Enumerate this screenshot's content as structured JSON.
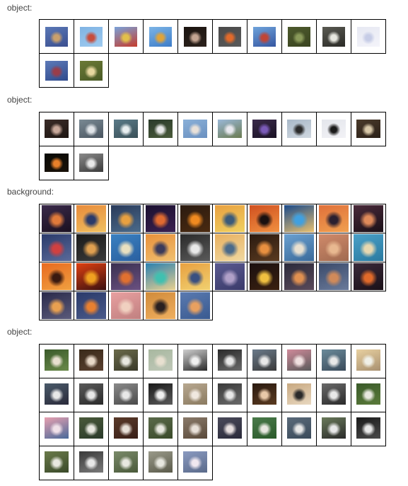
{
  "sections": [
    {
      "label": "object:",
      "type": "object-a",
      "images": [
        {
          "name": "blue-hot-air-balloon",
          "colors": [
            "#5a78b6",
            "#c9a06c",
            "#3b4f8f"
          ]
        },
        {
          "name": "red-balloon-small",
          "colors": [
            "#7fb3e3",
            "#c84d3c",
            "#9fcbf0"
          ]
        },
        {
          "name": "yellow-red-balloon",
          "colors": [
            "#7aa2d9",
            "#e2c04a",
            "#c53c2c"
          ]
        },
        {
          "name": "colorful-balloon",
          "colors": [
            "#7cb4e6",
            "#e0a43a",
            "#3d7cc8"
          ]
        },
        {
          "name": "dark-portrait",
          "colors": [
            "#1b1410",
            "#c4a592",
            "#2c221c"
          ]
        },
        {
          "name": "orange-figure",
          "colors": [
            "#4a4a4a",
            "#e26a2a",
            "#5a5a5a"
          ]
        },
        {
          "name": "balloon-flag",
          "colors": [
            "#6fa3db",
            "#c04536",
            "#3556a0"
          ]
        },
        {
          "name": "green-plant",
          "colors": [
            "#4d5a2d",
            "#8a9a5a",
            "#3a4420"
          ]
        },
        {
          "name": "white-flower-stem",
          "colors": [
            "#5a5a52",
            "#e8e8e0",
            "#2a2a26"
          ]
        },
        {
          "name": "pale-blue-object",
          "colors": [
            "#e6e8f2",
            "#c6cce6",
            "#f4f4fa"
          ]
        },
        {
          "name": "balloon-sky",
          "colors": [
            "#5d7ab8",
            "#9a3d4a",
            "#2f4a8c"
          ]
        },
        {
          "name": "bud-flower",
          "colors": [
            "#6b7a36",
            "#e8d8a0",
            "#4a5a26"
          ]
        }
      ]
    },
    {
      "label": "object:",
      "type": "object-b",
      "images": [
        {
          "name": "dark-flower",
          "colors": [
            "#3a2c28",
            "#c8a89a",
            "#1e1612"
          ]
        },
        {
          "name": "bird-flying",
          "colors": [
            "#7a8a94",
            "#e0e4e8",
            "#4a5560"
          ]
        },
        {
          "name": "bird-water",
          "colors": [
            "#5a7a88",
            "#e8eef0",
            "#3a5058"
          ]
        },
        {
          "name": "bird-branch",
          "colors": [
            "#2a3a2a",
            "#e8e8e8",
            "#4a5a3a"
          ]
        },
        {
          "name": "bird-sky",
          "colors": [
            "#8ab0d8",
            "#e8e0d8",
            "#6a90c0"
          ]
        },
        {
          "name": "blossom-branch",
          "colors": [
            "#9ab8d8",
            "#e8e8ee",
            "#6a7a50"
          ]
        },
        {
          "name": "purple-flower",
          "colors": [
            "#3a2a4a",
            "#7a5ab8",
            "#1a1224"
          ]
        },
        {
          "name": "bird-silhouette",
          "colors": [
            "#a8b8c8",
            "#2a2a2a",
            "#d0d8e0"
          ]
        },
        {
          "name": "black-bird",
          "colors": [
            "#e4e6ec",
            "#1a1a1a",
            "#f2f2f6"
          ]
        },
        {
          "name": "brown-flower",
          "colors": [
            "#4a3a2a",
            "#d8c8a8",
            "#2a2018"
          ]
        },
        {
          "name": "orange-lily",
          "colors": [
            "#0a0a06",
            "#e8802a",
            "#1a1208"
          ]
        },
        {
          "name": "gray-sign",
          "colors": [
            "#8a8a8a",
            "#e8e8e8",
            "#3a3a3a"
          ]
        }
      ]
    },
    {
      "label": "background:",
      "type": "background",
      "images": [
        {
          "name": "sunset-1",
          "colors": [
            "#3a2a4a",
            "#e07a3a",
            "#1a1020"
          ]
        },
        {
          "name": "sunset-2",
          "colors": [
            "#e88a3a",
            "#2a3a6a",
            "#f0c060"
          ]
        },
        {
          "name": "sunset-3",
          "colors": [
            "#2a3a5a",
            "#e8a040",
            "#4a6a8a"
          ]
        },
        {
          "name": "sunset-4",
          "colors": [
            "#1a1030",
            "#e06a30",
            "#3a2050"
          ]
        },
        {
          "name": "sunset-5",
          "colors": [
            "#2a1a10",
            "#f08a20",
            "#4a2a10"
          ]
        },
        {
          "name": "sunset-6",
          "colors": [
            "#e8a040",
            "#3a5a7a",
            "#f0d060"
          ]
        },
        {
          "name": "sunset-7",
          "colors": [
            "#d05020",
            "#1a1010",
            "#f09040"
          ]
        },
        {
          "name": "sunset-8",
          "colors": [
            "#1a4a8a",
            "#40a0e0",
            "#e8c070"
          ]
        },
        {
          "name": "sunset-9",
          "colors": [
            "#e0703a",
            "#2a2030",
            "#f0a050"
          ]
        },
        {
          "name": "sunset-10",
          "colors": [
            "#4a2a3a",
            "#e08a5a",
            "#1a1018"
          ]
        },
        {
          "name": "sunset-11",
          "colors": [
            "#2a3a6a",
            "#d04040",
            "#5a6a9a"
          ]
        },
        {
          "name": "sunset-12",
          "colors": [
            "#1a1a1a",
            "#e0a050",
            "#3a3a3a"
          ]
        },
        {
          "name": "sunset-13",
          "colors": [
            "#3a80c0",
            "#e8e0c0",
            "#2a60a0"
          ]
        },
        {
          "name": "sunset-14",
          "colors": [
            "#e8903a",
            "#3a3a5a",
            "#f0c070"
          ]
        },
        {
          "name": "sunset-15",
          "colors": [
            "#2a2a2a",
            "#e8e8e8",
            "#5a5a5a"
          ]
        },
        {
          "name": "sunset-16",
          "colors": [
            "#e8b060",
            "#4a6a8a",
            "#f0d8a0"
          ]
        },
        {
          "name": "sunset-17",
          "colors": [
            "#2a1a10",
            "#e89040",
            "#5a3a20"
          ]
        },
        {
          "name": "sunset-18",
          "colors": [
            "#6aa0d0",
            "#e8e0d0",
            "#3a6a9a"
          ]
        },
        {
          "name": "sunset-19",
          "colors": [
            "#d08a6a",
            "#e8b890",
            "#a06a50"
          ]
        },
        {
          "name": "sunset-20",
          "colors": [
            "#4aa0c8",
            "#e8d8b0",
            "#2a7aa0"
          ]
        },
        {
          "name": "sunset-21",
          "colors": [
            "#e86a20",
            "#3a1a10",
            "#f0a040"
          ]
        },
        {
          "name": "sunset-22",
          "colors": [
            "#e04010",
            "#f0a020",
            "#3a1010"
          ]
        },
        {
          "name": "sunset-23",
          "colors": [
            "#3a3050",
            "#e07030",
            "#6a5080"
          ]
        },
        {
          "name": "sunset-24",
          "colors": [
            "#2a80b0",
            "#40c0b0",
            "#e8d090"
          ]
        },
        {
          "name": "sunset-25",
          "colors": [
            "#e8a040",
            "#3a5080",
            "#f0d070"
          ]
        },
        {
          "name": "sunset-26",
          "colors": [
            "#5a5a90",
            "#b0a0c8",
            "#3a3a6a"
          ]
        },
        {
          "name": "sunset-27",
          "colors": [
            "#1a1010",
            "#f0c040",
            "#3a2010"
          ]
        },
        {
          "name": "sunset-28",
          "colors": [
            "#2a2a3a",
            "#e09050",
            "#5a4a5a"
          ]
        },
        {
          "name": "sunset-29",
          "colors": [
            "#3a4a6a",
            "#d08a5a",
            "#6a7a9a"
          ]
        },
        {
          "name": "sunset-30",
          "colors": [
            "#3a2a3a",
            "#e06a2a",
            "#1a1018"
          ]
        },
        {
          "name": "sunset-31",
          "colors": [
            "#2a2a4a",
            "#e8a050",
            "#5a5a7a"
          ]
        },
        {
          "name": "sunset-32",
          "colors": [
            "#2a3a6a",
            "#e88030",
            "#4a5a8a"
          ]
        },
        {
          "name": "sunset-33",
          "colors": [
            "#e8a0a0",
            "#f0d0c0",
            "#c08080"
          ]
        },
        {
          "name": "sunset-34",
          "colors": [
            "#d08a3a",
            "#2a2020",
            "#f0b060"
          ]
        },
        {
          "name": "sunset-35",
          "colors": [
            "#5a7ab0",
            "#e8a060",
            "#3a5a90"
          ]
        }
      ]
    },
    {
      "label": "object:",
      "type": "wedding",
      "images": [
        {
          "name": "wedding-1",
          "colors": [
            "#3a5a2a",
            "#e8e0d0",
            "#6a8a4a"
          ]
        },
        {
          "name": "wedding-2",
          "colors": [
            "#3a2a1a",
            "#e8d8c8",
            "#5a4030"
          ]
        },
        {
          "name": "wedding-3",
          "colors": [
            "#6a6a4a",
            "#e8e8e0",
            "#3a3a2a"
          ]
        },
        {
          "name": "wedding-4",
          "colors": [
            "#a8b8a0",
            "#e8e0d0",
            "#c0c8b8"
          ]
        },
        {
          "name": "wedding-5",
          "colors": [
            "#d0d0d0",
            "#f0f0f0",
            "#2a2a2a"
          ]
        },
        {
          "name": "wedding-6",
          "colors": [
            "#2a2a2a",
            "#e8e8e8",
            "#6a6a6a"
          ]
        },
        {
          "name": "wedding-7",
          "colors": [
            "#6a7a8a",
            "#e8e8e8",
            "#3a3a3a"
          ]
        },
        {
          "name": "wedding-8",
          "colors": [
            "#d08a9a",
            "#f0e0e0",
            "#5a5a5a"
          ]
        },
        {
          "name": "wedding-9",
          "colors": [
            "#6a8a9a",
            "#e8e8e8",
            "#3a4a5a"
          ]
        },
        {
          "name": "wedding-10",
          "colors": [
            "#e8d0a0",
            "#f0f0e8",
            "#a89070"
          ]
        },
        {
          "name": "wedding-11",
          "colors": [
            "#4a5a6a",
            "#e8e8e8",
            "#2a2a3a"
          ]
        },
        {
          "name": "wedding-12",
          "colors": [
            "#5a5a5a",
            "#e8e8e8",
            "#2a2a2a"
          ]
        },
        {
          "name": "wedding-13",
          "colors": [
            "#8a8a8a",
            "#e8e8e8",
            "#4a4a4a"
          ]
        },
        {
          "name": "wedding-14",
          "colors": [
            "#1a1a1a",
            "#f0f0f0",
            "#5a5a5a"
          ]
        },
        {
          "name": "wedding-15",
          "colors": [
            "#b8a890",
            "#f0e8e0",
            "#8a7a60"
          ]
        },
        {
          "name": "wedding-16",
          "colors": [
            "#3a3a3a",
            "#e8e8e8",
            "#6a6a6a"
          ]
        },
        {
          "name": "wedding-17",
          "colors": [
            "#2a1a10",
            "#e8c8a8",
            "#5a3a20"
          ]
        },
        {
          "name": "wedding-18",
          "colors": [
            "#c8a880",
            "#2a2a2a",
            "#e8d8c0"
          ]
        },
        {
          "name": "wedding-19",
          "colors": [
            "#6a6a6a",
            "#e8e8e8",
            "#2a2a2a"
          ]
        },
        {
          "name": "wedding-20",
          "colors": [
            "#3a5a2a",
            "#e8e8e0",
            "#5a7a3a"
          ]
        },
        {
          "name": "wedding-21",
          "colors": [
            "#e8a0b0",
            "#f0e0e8",
            "#4a6a9a"
          ]
        },
        {
          "name": "wedding-22",
          "colors": [
            "#4a5a3a",
            "#e8e8e0",
            "#2a3a2a"
          ]
        },
        {
          "name": "wedding-23",
          "colors": [
            "#5a3a2a",
            "#e8e0d8",
            "#3a2018"
          ]
        },
        {
          "name": "wedding-24",
          "colors": [
            "#5a6a4a",
            "#e8e8e0",
            "#3a4a2a"
          ]
        },
        {
          "name": "wedding-25",
          "colors": [
            "#8a7a6a",
            "#e8e0d8",
            "#5a4a3a"
          ]
        },
        {
          "name": "wedding-26",
          "colors": [
            "#4a4a5a",
            "#e8e0e0",
            "#2a2a3a"
          ]
        },
        {
          "name": "wedding-27",
          "colors": [
            "#4a7a4a",
            "#e8e8e0",
            "#2a5a2a"
          ]
        },
        {
          "name": "wedding-28",
          "colors": [
            "#5a6a7a",
            "#e8e8e8",
            "#3a4a5a"
          ]
        },
        {
          "name": "wedding-29",
          "colors": [
            "#6a7a5a",
            "#e8e8e8",
            "#2a2a2a"
          ]
        },
        {
          "name": "wedding-30",
          "colors": [
            "#1a1a1a",
            "#e8e8e8",
            "#4a4a4a"
          ]
        },
        {
          "name": "wedding-31",
          "colors": [
            "#6a7a4a",
            "#e8e8e0",
            "#3a4a2a"
          ]
        },
        {
          "name": "wedding-32",
          "colors": [
            "#3a3a3a",
            "#e8e8e8",
            "#7a7a7a"
          ]
        },
        {
          "name": "wedding-33",
          "colors": [
            "#7a8a6a",
            "#e8e8e0",
            "#4a5a3a"
          ]
        },
        {
          "name": "wedding-34",
          "colors": [
            "#9a9a8a",
            "#e8e8e0",
            "#5a5a4a"
          ]
        },
        {
          "name": "wedding-35",
          "colors": [
            "#8a9ac0",
            "#f0e8f0",
            "#5a6a8a"
          ]
        }
      ]
    }
  ]
}
